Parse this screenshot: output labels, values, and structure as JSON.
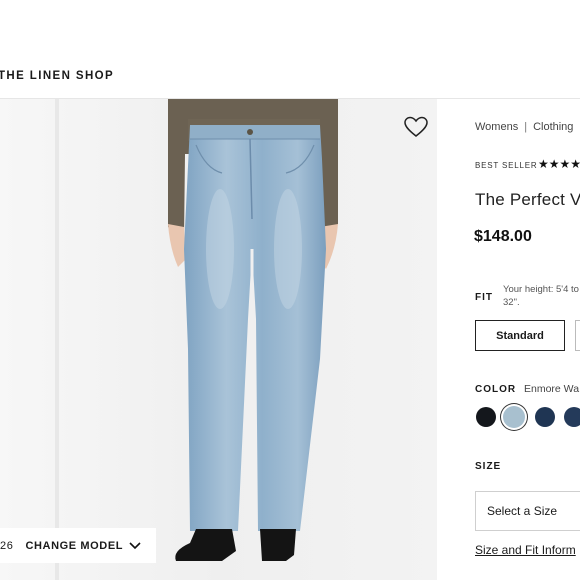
{
  "header": {
    "brand": "THE LINEN SHOP"
  },
  "gallery": {
    "model_size": "26",
    "change_model_label": "CHANGE MODEL"
  },
  "product": {
    "breadcrumb": [
      "Womens",
      "Clothing"
    ],
    "badge": "BEST SELLER",
    "rating_stars": "★★★★",
    "title": "The Perfect V",
    "price": "$148.00",
    "fit_label": "FIT",
    "fit_note": "Your height: 5'4 to 32\".",
    "fit_options": [
      "Standard"
    ],
    "color_label": "COLOR",
    "color_name": "Enmore Wa",
    "swatches": [
      "#14171c",
      "#a8c0cf",
      "#1f3553",
      "#243a5a"
    ],
    "size_label": "SIZE",
    "size_placeholder": "Select a Size",
    "size_fit_link": "Size and Fit Inform"
  }
}
